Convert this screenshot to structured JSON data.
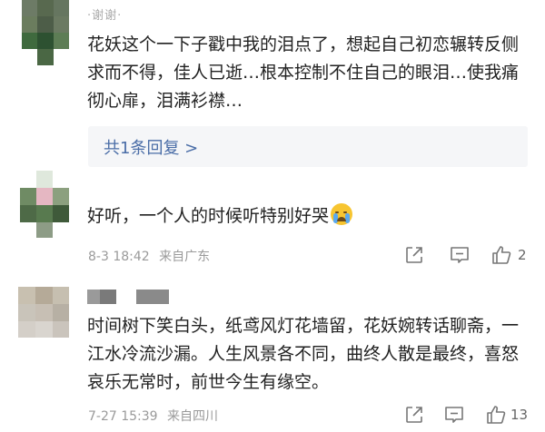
{
  "comments": [
    {
      "username": "·谢谢·",
      "text": "花妖这个一下子戳中我的泪点了，想起自己初恋辗转反侧求而不得，佳人已逝…根本控制不住自己的眼泪…使我痛彻心扉，泪满衫襟…",
      "reply_link": "共1条回复 >"
    },
    {
      "text": "好听，一个人的时候听特别好哭",
      "emoji": "crying-face",
      "date": "8-3 18:42",
      "location": "来自广东",
      "likes": "2"
    },
    {
      "text": "时间树下笑白头，纸鸢风灯花墙留，花妖婉转话聊斋，一江水冷流沙漏。人生风景各不同，曲终人散是最终，喜怒哀乐无常时，前世今生有缘空。",
      "date": "7-27 15:39",
      "location": "来自四川",
      "likes": "13"
    }
  ],
  "icons": {
    "share": "share-icon",
    "comment": "comment-icon",
    "like": "like-icon"
  },
  "colors": {
    "link": "#4a6da7",
    "meta": "#9a9a9a",
    "reply_bg": "#f5f6f8"
  }
}
